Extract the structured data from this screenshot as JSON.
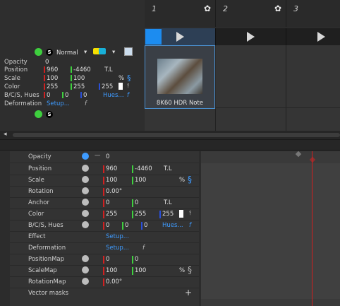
{
  "columns": [
    {
      "number": "1",
      "star": "✿"
    },
    {
      "number": "2",
      "star": "✿"
    },
    {
      "number": "3",
      "star": ""
    }
  ],
  "clip": {
    "name": "8K60 HDR Note"
  },
  "layer": {
    "blend": "Normal",
    "props": [
      {
        "label": "Opacity",
        "v1": "0"
      },
      {
        "label": "Position",
        "v1": "960",
        "v2": "-4460",
        "v3": "T.L"
      },
      {
        "label": "Scale",
        "v1": "100",
        "v2": "100",
        "v3": "%"
      },
      {
        "label": "Color",
        "v1": "255",
        "v2": "255",
        "v3": "255"
      },
      {
        "label": "B/C/S, Hues",
        "v1": "0",
        "v2": "0",
        "v3": "0",
        "link": "Hues..."
      },
      {
        "label": "Deformation",
        "link": "Setup..."
      }
    ]
  },
  "panel": {
    "rows": [
      {
        "name": "Opacity",
        "v1": "0"
      },
      {
        "name": "Position",
        "v1": "960",
        "v2": "-4460",
        "v3": "T.L"
      },
      {
        "name": "Scale",
        "v1": "100",
        "v2": "100",
        "v3": "%"
      },
      {
        "name": "Rotation",
        "v1": "0.00°"
      },
      {
        "name": "Anchor",
        "v1": "0",
        "v2": "0",
        "v3": "T.L"
      },
      {
        "name": "Color",
        "v1": "255",
        "v2": "255",
        "v3": "255"
      },
      {
        "name": "B/C/S, Hues",
        "v1": "0",
        "v2": "0",
        "v3": "0",
        "link": "Hues..."
      },
      {
        "name": "Effect",
        "link": "Setup..."
      },
      {
        "name": "Deformation",
        "link": "Setup..."
      },
      {
        "name": "PositionMap",
        "v1": "0",
        "v2": "0"
      },
      {
        "name": "ScaleMap",
        "v1": "100",
        "v2": "100",
        "v3": "%"
      },
      {
        "name": "RotationMap",
        "v1": "0.00°"
      },
      {
        "name": "Vector masks",
        "plus": "+"
      }
    ]
  },
  "colors": {
    "accent": "#1c8cf0",
    "red": "#d02020",
    "green": "#3ecf3e",
    "blue": "#2a4fd8"
  }
}
